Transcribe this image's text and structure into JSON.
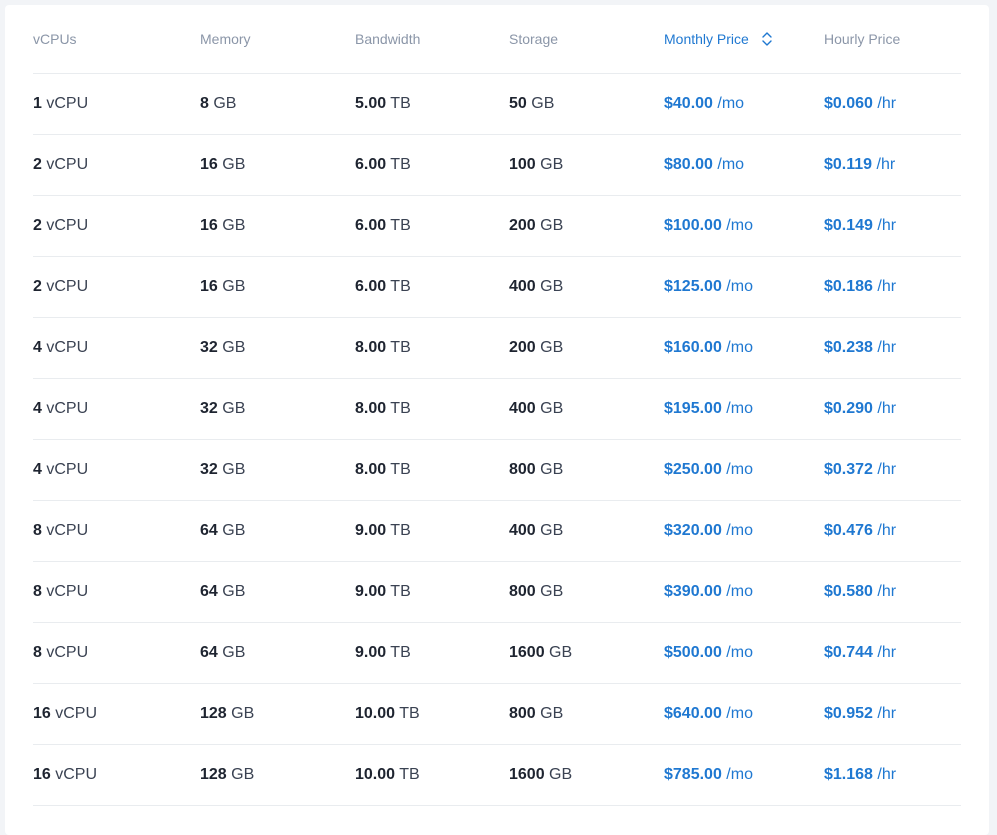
{
  "headers": {
    "vcpus": "vCPUs",
    "memory": "Memory",
    "bandwidth": "Bandwidth",
    "storage": "Storage",
    "monthly": "Monthly Price",
    "hourly": "Hourly Price"
  },
  "sort": {
    "column": "monthly",
    "icon": "sort-icon"
  },
  "colors": {
    "accent": "#1f78d1",
    "text": "#1e2430",
    "muted": "#8b96a8"
  },
  "rows": [
    {
      "vcpu": "1",
      "vcpu_unit": "vCPU",
      "mem": "8",
      "mem_unit": "GB",
      "bw": "5.00",
      "bw_unit": "TB",
      "sto": "50",
      "sto_unit": "GB",
      "mo": "$40.00",
      "mo_unit": "/mo",
      "hr": "$0.060",
      "hr_unit": "/hr"
    },
    {
      "vcpu": "2",
      "vcpu_unit": "vCPU",
      "mem": "16",
      "mem_unit": "GB",
      "bw": "6.00",
      "bw_unit": "TB",
      "sto": "100",
      "sto_unit": "GB",
      "mo": "$80.00",
      "mo_unit": "/mo",
      "hr": "$0.119",
      "hr_unit": "/hr"
    },
    {
      "vcpu": "2",
      "vcpu_unit": "vCPU",
      "mem": "16",
      "mem_unit": "GB",
      "bw": "6.00",
      "bw_unit": "TB",
      "sto": "200",
      "sto_unit": "GB",
      "mo": "$100.00",
      "mo_unit": "/mo",
      "hr": "$0.149",
      "hr_unit": "/hr"
    },
    {
      "vcpu": "2",
      "vcpu_unit": "vCPU",
      "mem": "16",
      "mem_unit": "GB",
      "bw": "6.00",
      "bw_unit": "TB",
      "sto": "400",
      "sto_unit": "GB",
      "mo": "$125.00",
      "mo_unit": "/mo",
      "hr": "$0.186",
      "hr_unit": "/hr"
    },
    {
      "vcpu": "4",
      "vcpu_unit": "vCPU",
      "mem": "32",
      "mem_unit": "GB",
      "bw": "8.00",
      "bw_unit": "TB",
      "sto": "200",
      "sto_unit": "GB",
      "mo": "$160.00",
      "mo_unit": "/mo",
      "hr": "$0.238",
      "hr_unit": "/hr"
    },
    {
      "vcpu": "4",
      "vcpu_unit": "vCPU",
      "mem": "32",
      "mem_unit": "GB",
      "bw": "8.00",
      "bw_unit": "TB",
      "sto": "400",
      "sto_unit": "GB",
      "mo": "$195.00",
      "mo_unit": "/mo",
      "hr": "$0.290",
      "hr_unit": "/hr"
    },
    {
      "vcpu": "4",
      "vcpu_unit": "vCPU",
      "mem": "32",
      "mem_unit": "GB",
      "bw": "8.00",
      "bw_unit": "TB",
      "sto": "800",
      "sto_unit": "GB",
      "mo": "$250.00",
      "mo_unit": "/mo",
      "hr": "$0.372",
      "hr_unit": "/hr"
    },
    {
      "vcpu": "8",
      "vcpu_unit": "vCPU",
      "mem": "64",
      "mem_unit": "GB",
      "bw": "9.00",
      "bw_unit": "TB",
      "sto": "400",
      "sto_unit": "GB",
      "mo": "$320.00",
      "mo_unit": "/mo",
      "hr": "$0.476",
      "hr_unit": "/hr"
    },
    {
      "vcpu": "8",
      "vcpu_unit": "vCPU",
      "mem": "64",
      "mem_unit": "GB",
      "bw": "9.00",
      "bw_unit": "TB",
      "sto": "800",
      "sto_unit": "GB",
      "mo": "$390.00",
      "mo_unit": "/mo",
      "hr": "$0.580",
      "hr_unit": "/hr"
    },
    {
      "vcpu": "8",
      "vcpu_unit": "vCPU",
      "mem": "64",
      "mem_unit": "GB",
      "bw": "9.00",
      "bw_unit": "TB",
      "sto": "1600",
      "sto_unit": "GB",
      "mo": "$500.00",
      "mo_unit": "/mo",
      "hr": "$0.744",
      "hr_unit": "/hr"
    },
    {
      "vcpu": "16",
      "vcpu_unit": "vCPU",
      "mem": "128",
      "mem_unit": "GB",
      "bw": "10.00",
      "bw_unit": "TB",
      "sto": "800",
      "sto_unit": "GB",
      "mo": "$640.00",
      "mo_unit": "/mo",
      "hr": "$0.952",
      "hr_unit": "/hr"
    },
    {
      "vcpu": "16",
      "vcpu_unit": "vCPU",
      "mem": "128",
      "mem_unit": "GB",
      "bw": "10.00",
      "bw_unit": "TB",
      "sto": "1600",
      "sto_unit": "GB",
      "mo": "$785.00",
      "mo_unit": "/mo",
      "hr": "$1.168",
      "hr_unit": "/hr"
    }
  ]
}
